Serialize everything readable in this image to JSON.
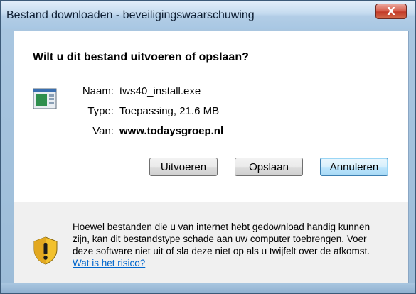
{
  "window": {
    "title": "Bestand downloaden - beveiligingswaarschuwing",
    "close_glyph": "X"
  },
  "dialog": {
    "question": "Wilt u dit bestand uitvoeren of opslaan?",
    "file": {
      "name_label": "Naam:",
      "name_value": "tws40_install.exe",
      "type_label": "Type:",
      "type_value": "Toepassing, 21.6 MB",
      "from_label": "Van:",
      "from_value": "www.todaysgroep.nl"
    },
    "buttons": {
      "run": "Uitvoeren",
      "save": "Opslaan",
      "cancel": "Annuleren"
    },
    "warning": {
      "text": "Hoewel bestanden die u van internet hebt gedownload handig kunnen zijn, kan dit bestandstype schade aan uw computer toebrengen. Voer deze software niet uit of sla deze niet op als u twijfelt over de afkomst.",
      "link": "Wat is het risico?"
    }
  },
  "colors": {
    "link": "#0066cc",
    "close_button": "#c23a28",
    "shield_yellow": "#f2c12e"
  }
}
